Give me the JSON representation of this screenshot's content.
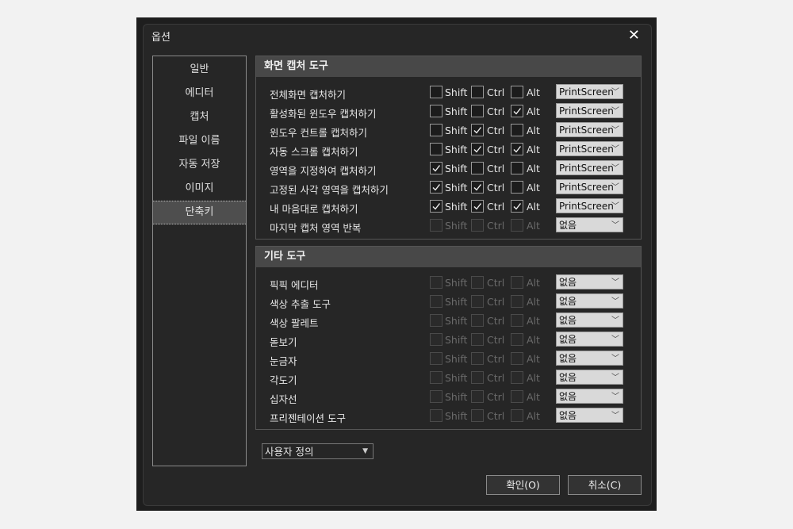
{
  "window": {
    "title": "옵션",
    "close": "✕"
  },
  "sidebar": {
    "items": [
      {
        "label": "일반"
      },
      {
        "label": "에디터"
      },
      {
        "label": "캡처"
      },
      {
        "label": "파일 이름"
      },
      {
        "label": "자동 저장"
      },
      {
        "label": "이미지"
      },
      {
        "label": "단축키",
        "active": true
      }
    ]
  },
  "modifiers": {
    "shift": "Shift",
    "ctrl": "Ctrl",
    "alt": "Alt"
  },
  "groups": [
    {
      "title": "화면 캡처 도구",
      "rows": [
        {
          "label": "전체화면 캡처하기",
          "shift": false,
          "ctrl": false,
          "alt": false,
          "key": "PrintScreen",
          "enabled": true
        },
        {
          "label": "활성화된 윈도우 캡처하기",
          "shift": false,
          "ctrl": false,
          "alt": true,
          "key": "PrintScreen",
          "enabled": true
        },
        {
          "label": "윈도우 컨트롤 캡처하기",
          "shift": false,
          "ctrl": true,
          "alt": false,
          "key": "PrintScreen",
          "enabled": true
        },
        {
          "label": "자동 스크롤 캡처하기",
          "shift": false,
          "ctrl": true,
          "alt": true,
          "key": "PrintScreen",
          "enabled": true
        },
        {
          "label": "영역을 지정하여 캡처하기",
          "shift": true,
          "ctrl": false,
          "alt": false,
          "key": "PrintScreen",
          "enabled": true
        },
        {
          "label": "고정된 사각 영역을 캡처하기",
          "shift": true,
          "ctrl": true,
          "alt": false,
          "key": "PrintScreen",
          "enabled": true
        },
        {
          "label": "내 마음대로 캡처하기",
          "shift": true,
          "ctrl": true,
          "alt": true,
          "key": "PrintScreen",
          "enabled": true
        },
        {
          "label": "마지막 캡처 영역 반복",
          "shift": false,
          "ctrl": false,
          "alt": false,
          "key": "없음",
          "enabled": false
        }
      ]
    },
    {
      "title": "기타 도구",
      "rows": [
        {
          "label": "픽픽 에디터",
          "shift": false,
          "ctrl": false,
          "alt": false,
          "key": "없음",
          "enabled": false
        },
        {
          "label": "색상 추출 도구",
          "shift": false,
          "ctrl": false,
          "alt": false,
          "key": "없음",
          "enabled": false
        },
        {
          "label": "색상 팔레트",
          "shift": false,
          "ctrl": false,
          "alt": false,
          "key": "없음",
          "enabled": false
        },
        {
          "label": "돋보기",
          "shift": false,
          "ctrl": false,
          "alt": false,
          "key": "없음",
          "enabled": false
        },
        {
          "label": "눈금자",
          "shift": false,
          "ctrl": false,
          "alt": false,
          "key": "없음",
          "enabled": false
        },
        {
          "label": "각도기",
          "shift": false,
          "ctrl": false,
          "alt": false,
          "key": "없음",
          "enabled": false
        },
        {
          "label": "십자선",
          "shift": false,
          "ctrl": false,
          "alt": false,
          "key": "없음",
          "enabled": false
        },
        {
          "label": "프리젠테이션 도구",
          "shift": false,
          "ctrl": false,
          "alt": false,
          "key": "없음",
          "enabled": false
        }
      ]
    }
  ],
  "preset": {
    "value": "사용자 정의"
  },
  "buttons": {
    "ok": "확인(O)",
    "cancel": "취소(C)"
  },
  "colors": {
    "background": "#262626",
    "header": "#484848",
    "combo": "#d9d9d9"
  }
}
